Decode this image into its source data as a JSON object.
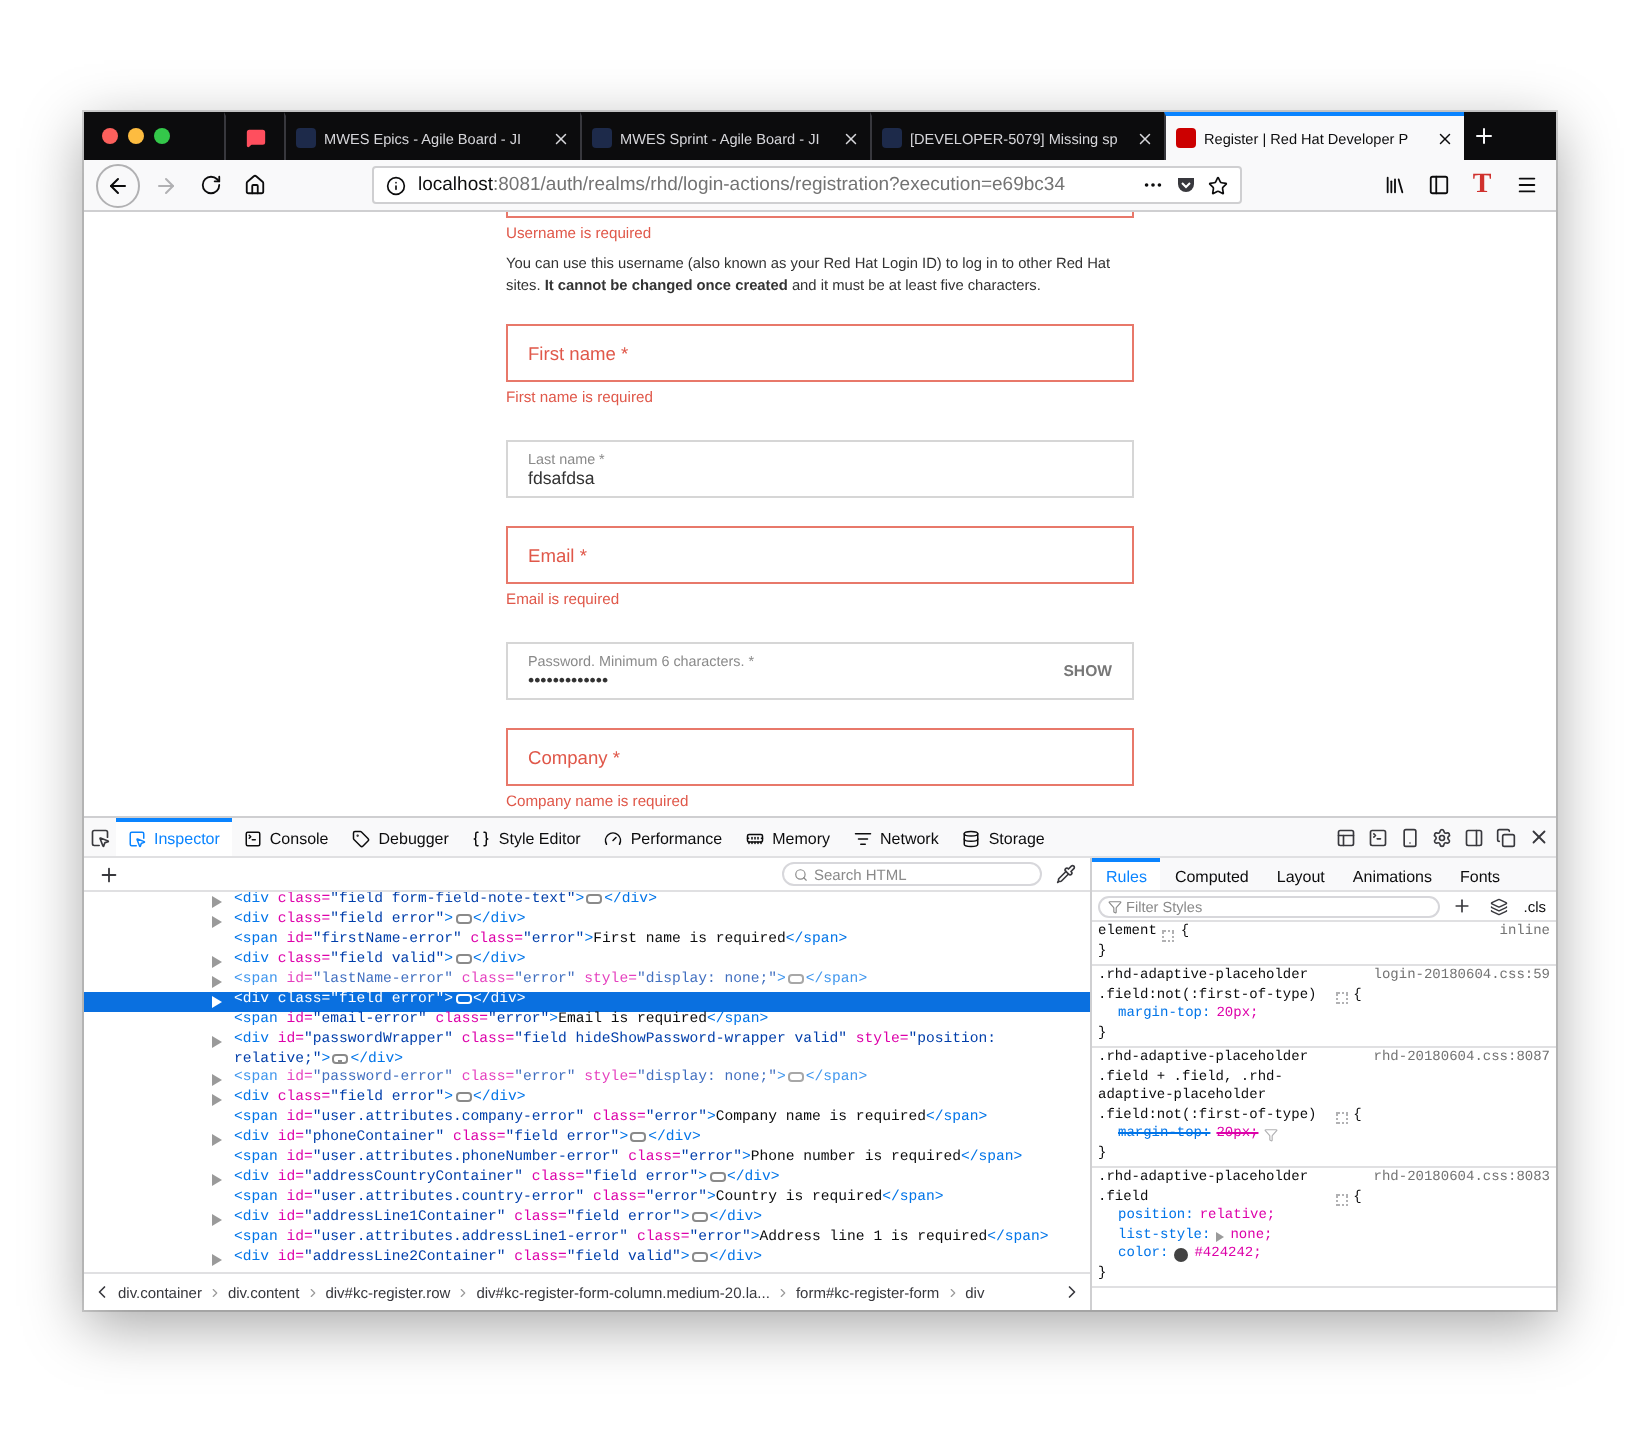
{
  "browser": {
    "tabs": [
      {
        "kind": "icon",
        "selected": false
      },
      {
        "kind": "page",
        "label": "MWES Epics - Agile Board - JI",
        "selected": false
      },
      {
        "kind": "page",
        "label": "MWES Sprint - Agile Board - JI",
        "selected": false
      },
      {
        "kind": "page",
        "label": "[DEVELOPER-5079] Missing sp",
        "selected": false
      },
      {
        "kind": "page",
        "label": "Register | Red Hat Developer P",
        "selected": true
      }
    ],
    "url": {
      "host": "localhost",
      "rest": ":8081/auth/realms/rhd/login-actions/registration?execution=e69bc34"
    },
    "extension_label": "T"
  },
  "page": {
    "top_error": "Username is required",
    "help": "You can use this username (also known as your Red Hat Login ID) to log in to other Red Hat sites. **It cannot be changed once created** and it must be at least five characters.",
    "fields": [
      {
        "kind": "error",
        "label": "First name *",
        "error": "First name is required"
      },
      {
        "kind": "filled",
        "label": "Last name *",
        "value": "fdsafdsa"
      },
      {
        "kind": "error",
        "label": "Email *",
        "error": "Email is required"
      },
      {
        "kind": "password",
        "label": "Password. Minimum 6 characters. *",
        "value": "•••••••••••••",
        "action": "SHOW"
      },
      {
        "kind": "error",
        "label": "Company *",
        "error": "Company name is required"
      }
    ]
  },
  "devtools": {
    "tools": [
      {
        "label": "Inspector",
        "selected": true
      },
      {
        "label": "Console",
        "selected": false
      },
      {
        "label": "Debugger",
        "selected": false
      },
      {
        "label": "Style Editor",
        "selected": false
      },
      {
        "label": "Performance",
        "selected": false
      },
      {
        "label": "Memory",
        "selected": false
      },
      {
        "label": "Network",
        "selected": false
      },
      {
        "label": "Storage",
        "selected": false
      }
    ],
    "search_placeholder": "Search HTML",
    "markup_lines": [
      {
        "expandable": true,
        "dimmed": false,
        "selected": false,
        "open": "<div class=\"field form-field-note-text\">",
        "collapsed": true,
        "close": "</div>"
      },
      {
        "expandable": true,
        "dimmed": false,
        "selected": false,
        "open": "<div class=\"field error\">",
        "collapsed": true,
        "close": "</div>"
      },
      {
        "expandable": false,
        "dimmed": false,
        "selected": false,
        "open": "<span id=\"firstName-error\" class=\"error\">First name is required</span>",
        "collapsed": false
      },
      {
        "expandable": true,
        "dimmed": false,
        "selected": false,
        "open": "<div class=\"field valid\">",
        "collapsed": true,
        "close": "</div>"
      },
      {
        "expandable": true,
        "dimmed": true,
        "selected": false,
        "open": "<span id=\"lastName-error\" class=\"error\" style=\"display: none;\">",
        "collapsed": true,
        "close": "</span>"
      },
      {
        "expandable": true,
        "dimmed": false,
        "selected": true,
        "open": "<div class=\"field error\">",
        "collapsed": true,
        "close": "</div>"
      },
      {
        "expandable": false,
        "dimmed": false,
        "selected": false,
        "open": "<span id=\"email-error\" class=\"error\">Email is required</span>",
        "collapsed": false
      },
      {
        "expandable": true,
        "dimmed": false,
        "selected": false,
        "open": "<div id=\"passwordWrapper\" class=\"field hideShowPassword-wrapper valid\" style=\"position: relative;\">",
        "collapsed": true,
        "close": "</div>"
      },
      {
        "expandable": true,
        "dimmed": true,
        "selected": false,
        "open": "<span id=\"password-error\" class=\"error\" style=\"display: none;\">",
        "collapsed": true,
        "close": "</span>"
      },
      {
        "expandable": true,
        "dimmed": false,
        "selected": false,
        "open": "<div class=\"field error\">",
        "collapsed": true,
        "close": "</div>"
      },
      {
        "expandable": false,
        "dimmed": false,
        "selected": false,
        "open": "<span id=\"user.attributes.company-error\" class=\"error\">Company name is required</span>",
        "collapsed": false
      },
      {
        "expandable": true,
        "dimmed": false,
        "selected": false,
        "open": "<div id=\"phoneContainer\" class=\"field error\">",
        "collapsed": true,
        "close": "</div>"
      },
      {
        "expandable": false,
        "dimmed": false,
        "selected": false,
        "open": "<span id=\"user.attributes.phoneNumber-error\" class=\"error\">Phone number is required</span>",
        "collapsed": false
      },
      {
        "expandable": true,
        "dimmed": false,
        "selected": false,
        "open": "<div id=\"addressCountryContainer\" class=\"field error\">",
        "collapsed": true,
        "close": "</div>"
      },
      {
        "expandable": false,
        "dimmed": false,
        "selected": false,
        "open": "<span id=\"user.attributes.country-error\" class=\"error\">Country is required</span>",
        "collapsed": false
      },
      {
        "expandable": true,
        "dimmed": false,
        "selected": false,
        "open": "<div id=\"addressLine1Container\" class=\"field error\">",
        "collapsed": true,
        "close": "</div>"
      },
      {
        "expandable": false,
        "dimmed": false,
        "selected": false,
        "open": "<span id=\"user.attributes.addressLine1-error\" class=\"error\">Address line 1 is required</span>",
        "collapsed": false
      },
      {
        "expandable": true,
        "dimmed": false,
        "selected": false,
        "open": "<div id=\"addressLine2Container\" class=\"field valid\">",
        "collapsed": true,
        "close": "</div>"
      }
    ],
    "breadcrumbs": [
      "div.container",
      "div.content",
      "div#kc-register.row",
      "div#kc-register-form-column.medium-20.la...",
      "form#kc-register-form",
      "div"
    ],
    "side_tabs": [
      {
        "label": "Rules",
        "selected": true
      },
      {
        "label": "Computed",
        "selected": false
      },
      {
        "label": "Layout",
        "selected": false
      },
      {
        "label": "Animations",
        "selected": false
      },
      {
        "label": "Fonts",
        "selected": false
      }
    ],
    "filter_placeholder": "Filter Styles",
    "cls_label": ".cls",
    "rules": [
      {
        "selector": "element",
        "source": "inline",
        "open": "{",
        "close": "}"
      },
      {
        "selector": ".rhd-adaptive-placeholder .field:not(:first-of-type)",
        "source": "login-20180604.css:59",
        "open": "{",
        "close": "}",
        "declarations": [
          {
            "property": "margin-top:",
            "value": "20px;",
            "overridden": false,
            "expandable": false
          }
        ]
      },
      {
        "selector": ".rhd-adaptive-placeholder .field + .field, .rhd-adaptive-placeholder .field:not(:first-of-type)",
        "source": "rhd-20180604.css:8087",
        "open": "{",
        "close": "}",
        "declarations": [
          {
            "property": "margin-top:",
            "value": "20px;",
            "overridden": true,
            "expandable": false
          }
        ]
      },
      {
        "selector": ".rhd-adaptive-placeholder .field",
        "source": "rhd-20180604.css:8083",
        "open": "{",
        "close": "}",
        "declarations": [
          {
            "property": "position:",
            "value": "relative;",
            "overridden": false,
            "expandable": false
          },
          {
            "property": "list-style:",
            "value": "none;",
            "overridden": false,
            "expandable": true
          },
          {
            "property": "color:",
            "value": "#424242;",
            "color": "#424242",
            "overridden": false,
            "expandable": false
          }
        ]
      }
    ]
  }
}
